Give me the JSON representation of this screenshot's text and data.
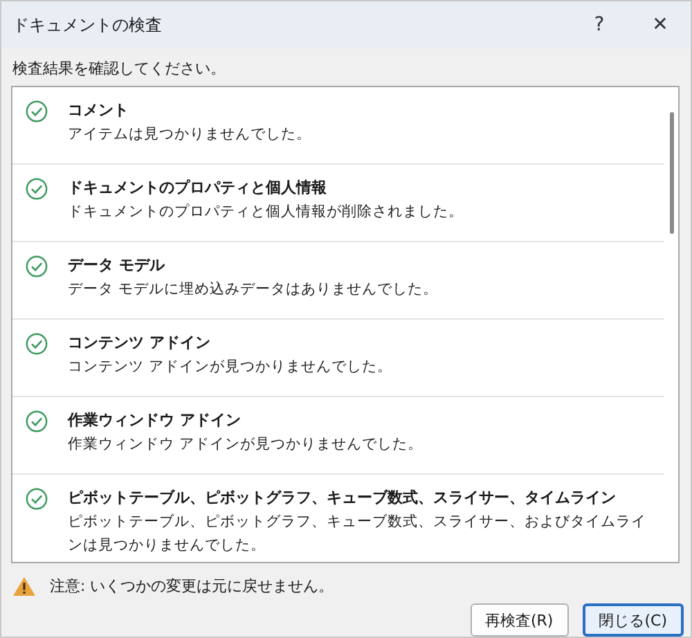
{
  "window": {
    "title": "ドキュメントの検査",
    "help": "?",
    "close": "✕"
  },
  "instruction": "検査結果を確認してください。",
  "results": [
    {
      "kind": "passed",
      "title": "コメント",
      "detail": "アイテムは見つかりませんでした。"
    },
    {
      "kind": "passed",
      "title": "ドキュメントのプロパティと個人情報",
      "detail": "ドキュメントのプロパティと個人情報が削除されました。"
    },
    {
      "kind": "passed",
      "title": "データ モデル",
      "detail": "データ モデルに埋め込みデータはありませんでした。"
    },
    {
      "kind": "passed",
      "title": "コンテンツ アドイン",
      "detail": "コンテンツ アドインが見つかりませんでした。"
    },
    {
      "kind": "passed",
      "title": "作業ウィンドウ アドイン",
      "detail": "作業ウィンドウ アドインが見つかりませんでした。"
    },
    {
      "kind": "passed",
      "title": "ピボットテーブル、ピボットグラフ、キューブ数式、スライサー、タイムライン",
      "detail": "ピボットテーブル、ピボットグラフ、キューブ数式、スライサー、およびタイムラインは見つかりませんでした。"
    }
  ],
  "warning": "注意: いくつかの変更は元に戻せません。",
  "buttons": [
    {
      "label": "再検査(R)",
      "selected": false
    },
    {
      "label": "閉じる(C)",
      "selected": true
    }
  ]
}
